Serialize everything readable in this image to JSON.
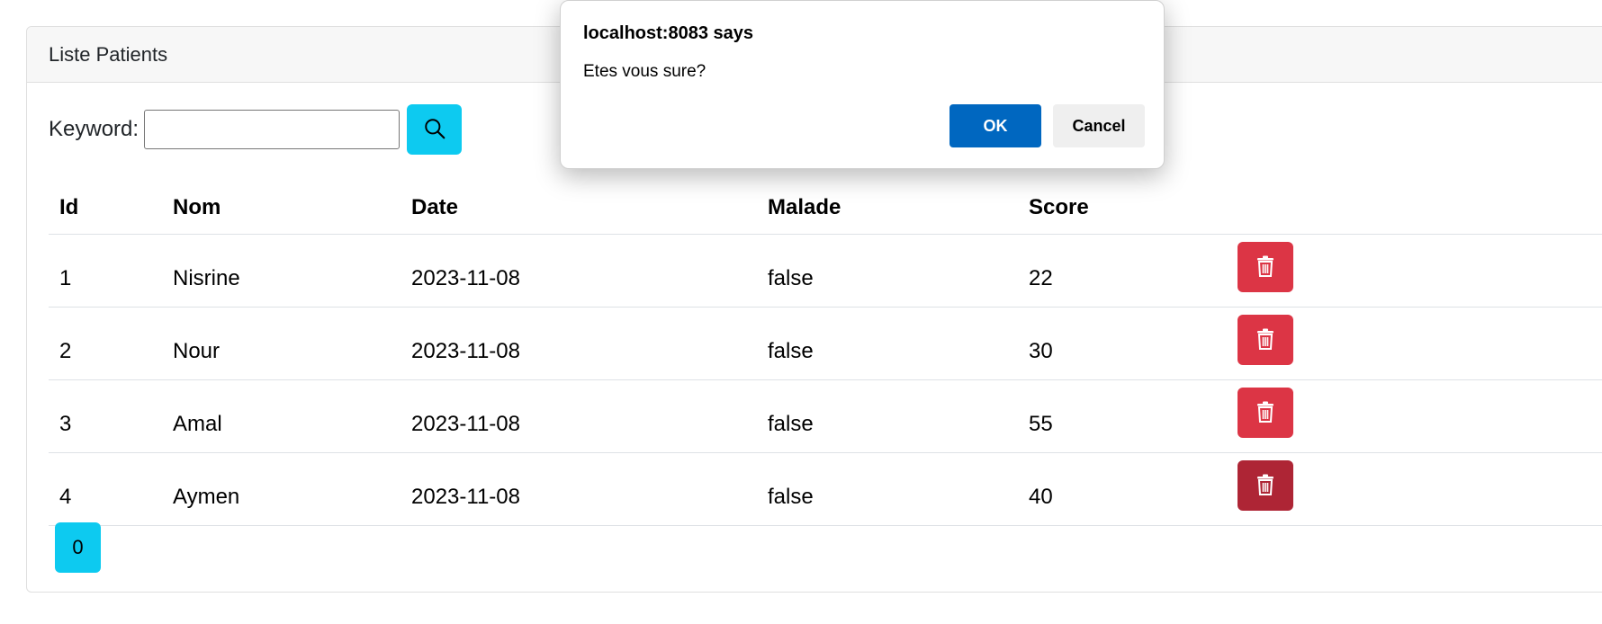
{
  "card": {
    "title": "Liste Patients"
  },
  "search": {
    "label": "Keyword:",
    "value": "",
    "placeholder": "",
    "button_icon": "search-icon"
  },
  "table": {
    "headers": [
      "Id",
      "Nom",
      "Date",
      "Malade",
      "Score"
    ],
    "rows": [
      {
        "id": "1",
        "nom": "Nisrine",
        "date": "2023-11-08",
        "malade": "false",
        "score": "22",
        "action_icon": "trash-icon"
      },
      {
        "id": "2",
        "nom": "Nour",
        "date": "2023-11-08",
        "malade": "false",
        "score": "30",
        "action_icon": "trash-icon"
      },
      {
        "id": "3",
        "nom": "Amal",
        "date": "2023-11-08",
        "malade": "false",
        "score": "55",
        "action_icon": "trash-icon"
      },
      {
        "id": "4",
        "nom": "Aymen",
        "date": "2023-11-08",
        "malade": "false",
        "score": "40",
        "action_icon": "trash-icon"
      }
    ]
  },
  "pagination": {
    "pages": [
      "0"
    ]
  },
  "dialog": {
    "title": "localhost:8083 says",
    "message": "Etes vous sure?",
    "ok_label": "OK",
    "cancel_label": "Cancel"
  },
  "colors": {
    "info": "#0dcaf0",
    "danger": "#dc3545",
    "danger_hover": "#ae2535",
    "dialog_primary": "#0067c0"
  }
}
